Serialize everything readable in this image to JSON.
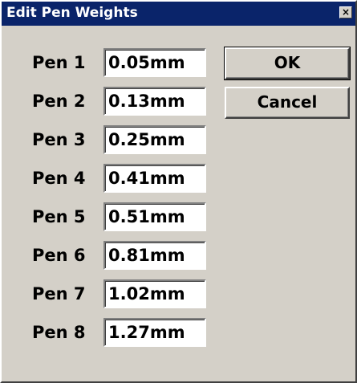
{
  "window": {
    "title": "Edit Pen Weights",
    "close_glyph": "×"
  },
  "pens": [
    {
      "label": "Pen 1",
      "value": "0.05mm"
    },
    {
      "label": "Pen 2",
      "value": "0.13mm"
    },
    {
      "label": "Pen 3",
      "value": "0.25mm"
    },
    {
      "label": "Pen 4",
      "value": "0.41mm"
    },
    {
      "label": "Pen 5",
      "value": "0.51mm"
    },
    {
      "label": "Pen 6",
      "value": "0.81mm"
    },
    {
      "label": "Pen 7",
      "value": "1.02mm"
    },
    {
      "label": "Pen 8",
      "value": "1.27mm"
    }
  ],
  "buttons": {
    "ok_label": "OK",
    "cancel_label": "Cancel"
  },
  "colors": {
    "titlebar": "#0a246a",
    "face": "#d4d0c8"
  }
}
